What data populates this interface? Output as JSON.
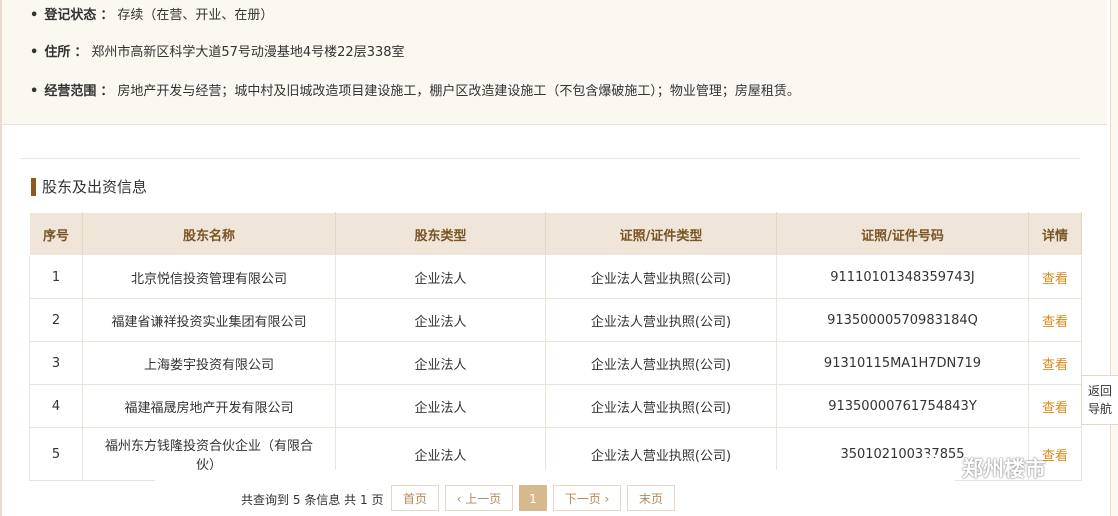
{
  "company_info": {
    "status_label": "登记状态",
    "status_value": "存续（在营、开业、在册）",
    "address_label": "住所",
    "address_value": "郑州市高新区科学大道57号动漫基地4号楼22层338室",
    "scope_label": "经营范围",
    "scope_value": "房地产开发与经营；城中村及旧城改造项目建设施工，棚户区改造建设施工（不包含爆破施工）；物业管理；房屋租赁。"
  },
  "shareholders": {
    "title": "股东及出资信息",
    "columns": [
      "序号",
      "股东名称",
      "股东类型",
      "证照/证件类型",
      "证照/证件号码",
      "详情"
    ],
    "rows": [
      {
        "no": "1",
        "name": "北京悦信投资管理有限公司",
        "type": "企业法人",
        "license_type": "企业法人营业执照(公司)",
        "license_no": "91110101348359743J",
        "detail": "查看"
      },
      {
        "no": "2",
        "name": "福建省谦祥投资实业集团有限公司",
        "type": "企业法人",
        "license_type": "企业法人营业执照(公司)",
        "license_no": "91350000570983184Q",
        "detail": "查看"
      },
      {
        "no": "3",
        "name": "上海娄宇投资有限公司",
        "type": "企业法人",
        "license_type": "企业法人营业执照(公司)",
        "license_no": "91310115MA1H7DN719",
        "detail": "查看"
      },
      {
        "no": "4",
        "name": "福建福晟房地产开发有限公司",
        "type": "企业法人",
        "license_type": "企业法人营业执照(公司)",
        "license_no": "91350000761754843Y",
        "detail": "查看"
      },
      {
        "no": "5",
        "name_line1": "福州东方钱隆投资合伙企业（有限合",
        "name_line2": "伙）",
        "type": "企业法人",
        "license_type": "企业法人营业执照(公司)",
        "license_no": "350102100337855",
        "detail": "查看"
      }
    ]
  },
  "pagination": {
    "summary_prefix": "共查询到",
    "total_count": "5",
    "summary_mid": "条信息  共",
    "total_pages": "1",
    "summary_suffix": "页",
    "first": "首页",
    "prev": "‹ 上一页",
    "current": "1",
    "next": "下一页 ›",
    "last": "末页"
  },
  "side_nav": {
    "line1": "返回",
    "line2": "导航"
  },
  "watermark": {
    "text": "郑州楼市",
    "icon": "wechat-icon"
  }
}
